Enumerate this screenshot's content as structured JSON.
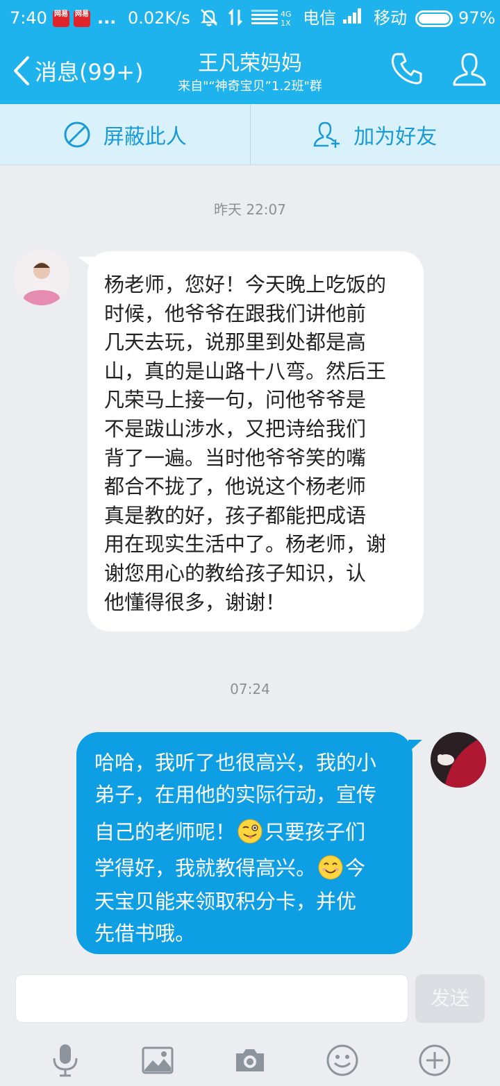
{
  "status_bar": {
    "time": "7:40",
    "app_badge": "网易",
    "dots": "...",
    "speed": "0.02K/s",
    "net_type": "4G",
    "net_type2": "1X",
    "carrier1": "电信",
    "carrier2": "移动",
    "battery": "97%"
  },
  "header": {
    "back_label": "消息(99+)",
    "title": "王凡荣妈妈",
    "subtitle": "来自\"“神奇宝贝”1.2班\"群"
  },
  "actions": {
    "block": "屏蔽此人",
    "add_friend": "加为好友"
  },
  "chat": {
    "time1": "昨天 22:07",
    "incoming_lines": [
      "杨老师，您好！今天晚上吃饭的",
      "时候，他爷爷在跟我们讲他前",
      "几天去玩，说那里到处都是高",
      "山，真的是山路十八弯。然后王",
      "凡荣马上接一句，问他爷爷是",
      "不是跋山涉水，又把诗给我们",
      "背了一遍。当时他爷爷笑的嘴",
      "都合不拢了，他说这个杨老师",
      "真是教的好，孩子都能把成语",
      "用在现实生活中了。杨老师，谢",
      "谢您用心的教给孩子知识，认",
      "他懂得很多，谢谢！"
    ],
    "time2": "07:24",
    "outgoing": {
      "l1": "哈哈，我听了也很高兴，我的小",
      "l2": "弟子，在用他的实际行动，宣传",
      "l3a": "自己的老师呢！",
      "l3b": "只要孩子们",
      "l4a": "学得好，我就教得高兴。",
      "l4b": "今",
      "l5": "天宝贝能来领取积分卡，并优",
      "l6": "先借书哦。"
    }
  },
  "input": {
    "send_label": "发送"
  },
  "colors": {
    "header_bg": "#1fb3ed",
    "outgoing_bubble": "#0e9ee3",
    "action_text": "#1a9ad6"
  }
}
